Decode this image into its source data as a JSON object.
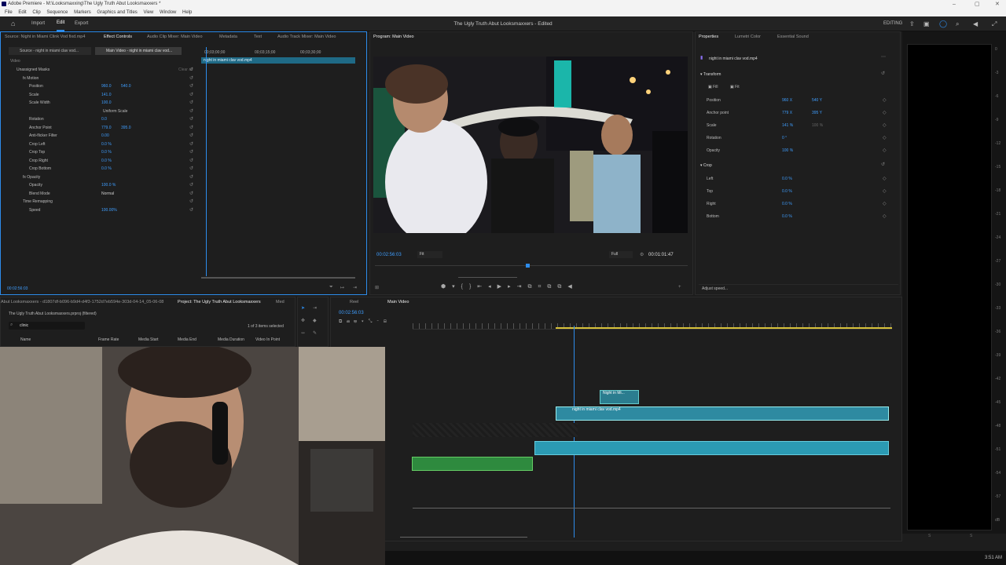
{
  "window": {
    "title": "Adobe Premiere - M:\\Looksmaxxing\\The Ugly Truth Abut Looksmaxxers *",
    "controls": [
      "–",
      "▢",
      "✕"
    ]
  },
  "menu": [
    "File",
    "Edit",
    "Clip",
    "Sequence",
    "Markers",
    "Graphics and Titles",
    "View",
    "Window",
    "Help"
  ],
  "header": {
    "tabs": [
      "Import",
      "Edit",
      "Export"
    ],
    "active_tab": "Edit",
    "doc_title": "The Ugly Truth Abut Looksmaxxers - Edited",
    "workspace": "EDITING"
  },
  "effect_controls": {
    "tabs": [
      "Source: Night in Miami Clink Vod fixd.mp4",
      "Effect Controls",
      "Audio Clip Mixer: Main Video",
      "Metadata",
      "Text",
      "Audio Track Mixer: Main Video"
    ],
    "source_label": "Source - night in miami clav vod...",
    "clip_label": "Main Video - night in miami clav vod...",
    "tc_start": "00;03;00;00",
    "tc_mid": "00;03;15;00",
    "tc_end": "00;03;30;00",
    "clip_bar_label": "night in miami clav vod.mp4",
    "video_header": "Video",
    "clear_all": "Clear all",
    "timecode": "00:02:56:03",
    "rows": [
      {
        "label": "Unassigned Masks",
        "value": "",
        "value2": ""
      },
      {
        "label": "fx  Motion",
        "value": "",
        "value2": ""
      },
      {
        "label": "Position",
        "value": "960.0",
        "value2": "540.0"
      },
      {
        "label": "Scale",
        "value": "141.0",
        "value2": ""
      },
      {
        "label": "Scale Width",
        "value": "100.0",
        "value2": ""
      },
      {
        "label": "Uniform Scale",
        "value": "",
        "value2": ""
      },
      {
        "label": "Rotation",
        "value": "0.0",
        "value2": ""
      },
      {
        "label": "Anchor Point",
        "value": "779.0",
        "value2": "395.0"
      },
      {
        "label": "Anti-flicker Filter",
        "value": "0.00",
        "value2": ""
      },
      {
        "label": "Crop Left",
        "value": "0.0 %",
        "value2": ""
      },
      {
        "label": "Crop Top",
        "value": "0.0 %",
        "value2": ""
      },
      {
        "label": "Crop Right",
        "value": "0.0 %",
        "value2": ""
      },
      {
        "label": "Crop Bottom",
        "value": "0.0 %",
        "value2": ""
      },
      {
        "label": "fx  Opacity",
        "value": "",
        "value2": ""
      },
      {
        "label": "Opacity",
        "value": "100.0 %",
        "value2": ""
      },
      {
        "label": "Blend Mode",
        "value": "Normal",
        "value2": ""
      },
      {
        "label": "Time Remapping",
        "value": "",
        "value2": ""
      },
      {
        "label": "Speed",
        "value": "100.00%",
        "value2": ""
      }
    ]
  },
  "program": {
    "title": "Program: Main Video",
    "timecode": "00:02:56:03",
    "fit": "Fit",
    "quality": "Full",
    "duration": "00:01:01:47"
  },
  "properties": {
    "tabs": [
      "Properties",
      "Lumetri Color",
      "Essential Sound"
    ],
    "clip_name": "night in miami clav vod.mp4",
    "transform_title": "Transform",
    "fill": "Fill",
    "fit": "Fit",
    "rows": [
      {
        "label": "Position",
        "v1": "960 X",
        "v2": "540 Y"
      },
      {
        "label": "Anchor point",
        "v1": "779 X",
        "v2": "395 Y"
      },
      {
        "label": "Scale",
        "v1": "141 %",
        "v2": "100 %"
      },
      {
        "label": "Rotation",
        "v1": "0 °",
        "v2": ""
      },
      {
        "label": "Opacity",
        "v1": "100 %",
        "v2": ""
      }
    ],
    "crop_title": "Crop",
    "crop_rows": [
      {
        "label": "Left",
        "v1": "0.0 %"
      },
      {
        "label": "Top",
        "v1": "0.0 %"
      },
      {
        "label": "Right",
        "v1": "0.0 %"
      },
      {
        "label": "Bottom",
        "v1": "0.0 %"
      }
    ],
    "adjust_speed": "Adjust speed..."
  },
  "project": {
    "tab_left": "Abut Looksmaxxers - d1807df-b096-b9d4-d4f3-1752d7eb594e-303d-04-14_05-06-08",
    "tab_right": "Project: The Ugly Truth Abut Looksmaxxers",
    "tab_extra": "Med",
    "path": "The Ugly Truth Abut Looksmaxxers.prproj (filtered)",
    "search": "clinic",
    "count": "1 of 3 items selected",
    "columns": [
      "Name",
      "Frame Rate",
      "Media Start",
      "Media End",
      "Media Duration",
      "Video In Point"
    ]
  },
  "timeline": {
    "tabs": [
      "Reel",
      "Main Video"
    ],
    "timecode": "00:02:56:03",
    "clips": [
      {
        "label": "Night in Mi..."
      },
      {
        "label": "night in miami clav vod.mp4"
      }
    ]
  },
  "meter_scale": [
    "0",
    "-3",
    "-6",
    "-9",
    "-12",
    "-15",
    "-18",
    "-21",
    "-24",
    "-27",
    "-30",
    "-33",
    "-36",
    "-39",
    "-42",
    "-45",
    "-48",
    "-51",
    "-54",
    "-57",
    "dB"
  ],
  "meter_footer": [
    "S",
    "S"
  ],
  "status": {
    "time": "3:51 AM"
  }
}
